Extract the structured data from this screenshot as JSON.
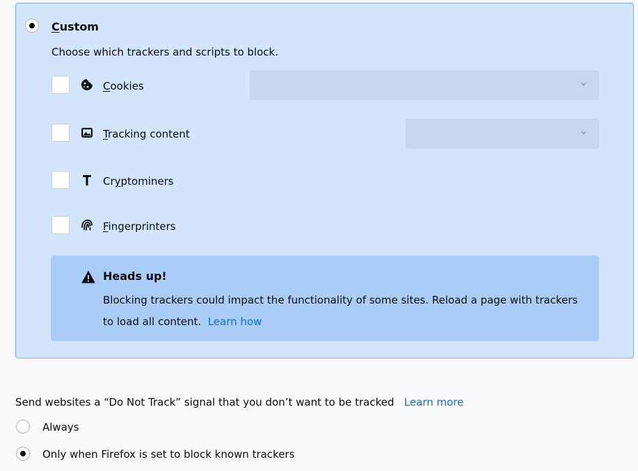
{
  "custom": {
    "title": "Custom",
    "title_access_key": "C",
    "title_rest": "ustom",
    "selected": true,
    "description": "Choose which trackers and scripts to block."
  },
  "trackers": {
    "cookies": {
      "access_key": "C",
      "rest": "ookies",
      "icon": "cookie-icon",
      "checked": false
    },
    "tracking_content": {
      "access_key": "T",
      "rest": "racking content",
      "icon": "image-icon",
      "checked": false
    },
    "cryptominers": {
      "before": "Cr",
      "access_key": "y",
      "rest": "ptominers",
      "icon": "hammer-icon",
      "checked": false
    },
    "fingerprinters": {
      "access_key": "F",
      "rest": "ingerprinters",
      "icon": "fingerprint-icon",
      "checked": false
    }
  },
  "heads_up": {
    "title": "Heads up!",
    "body": "Blocking trackers could impact the functionality of some sites. Reload a page with trackers to load all content.",
    "link": "Learn how"
  },
  "dnt": {
    "label": "Send websites a “Do Not Track” signal that you don’t want to be tracked",
    "link": "Learn more",
    "options": [
      {
        "label": "Always",
        "selected": false
      },
      {
        "label": "Only when Firefox is set to block known trackers",
        "selected": true
      }
    ]
  },
  "colors": {
    "panel_bg": "#d2e5fb",
    "panel_border": "#7eb0ec",
    "headsup_bg": "#a9cdf6",
    "link": "#0a70e0"
  }
}
